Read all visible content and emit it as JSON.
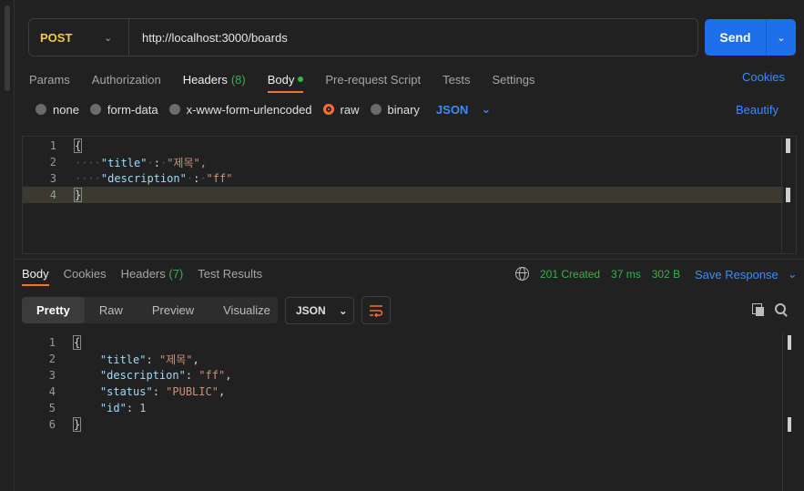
{
  "request": {
    "method": "POST",
    "url": "http://localhost:3000/boards",
    "send_label": "Send",
    "tabs": [
      {
        "label": "Params"
      },
      {
        "label": "Authorization"
      },
      {
        "label": "Headers",
        "count": "(8)"
      },
      {
        "label": "Body"
      },
      {
        "label": "Pre-request Script"
      },
      {
        "label": "Tests"
      },
      {
        "label": "Settings"
      }
    ],
    "cookies_label": "Cookies",
    "body_types": [
      "none",
      "form-data",
      "x-www-form-urlencoded",
      "raw",
      "binary"
    ],
    "selected_body_type": "raw",
    "format": "JSON",
    "beautify_label": "Beautify",
    "body_lines": [
      {
        "no": "1",
        "text": "{"
      },
      {
        "no": "2",
        "key": "\"title\"",
        "value": "\"제목\","
      },
      {
        "no": "3",
        "key": "\"description\"",
        "value": "\"ff\""
      },
      {
        "no": "4",
        "text": "}"
      }
    ]
  },
  "response": {
    "tabs": [
      {
        "label": "Body"
      },
      {
        "label": "Cookies"
      },
      {
        "label": "Headers",
        "count": "(7)"
      },
      {
        "label": "Test Results"
      }
    ],
    "status": "201 Created",
    "time": "37 ms",
    "size": "302 B",
    "save_label": "Save Response",
    "views": [
      "Pretty",
      "Raw",
      "Preview",
      "Visualize"
    ],
    "format": "JSON",
    "body_lines": [
      {
        "no": "1",
        "text": "{"
      },
      {
        "no": "2",
        "key": "\"title\"",
        "value": "\"제목\"",
        "punct": ","
      },
      {
        "no": "3",
        "key": "\"description\"",
        "value": "\"ff\"",
        "punct": ","
      },
      {
        "no": "4",
        "key": "\"status\"",
        "value": "\"PUBLIC\"",
        "punct": ","
      },
      {
        "no": "5",
        "key": "\"id\"",
        "num": "1"
      },
      {
        "no": "6",
        "text": "}"
      }
    ]
  },
  "colors": {
    "accent_orange": "#ff6c37",
    "link_blue": "#3d8bfd",
    "status_green": "#37b24d",
    "method_yellow": "#f2c94c"
  }
}
